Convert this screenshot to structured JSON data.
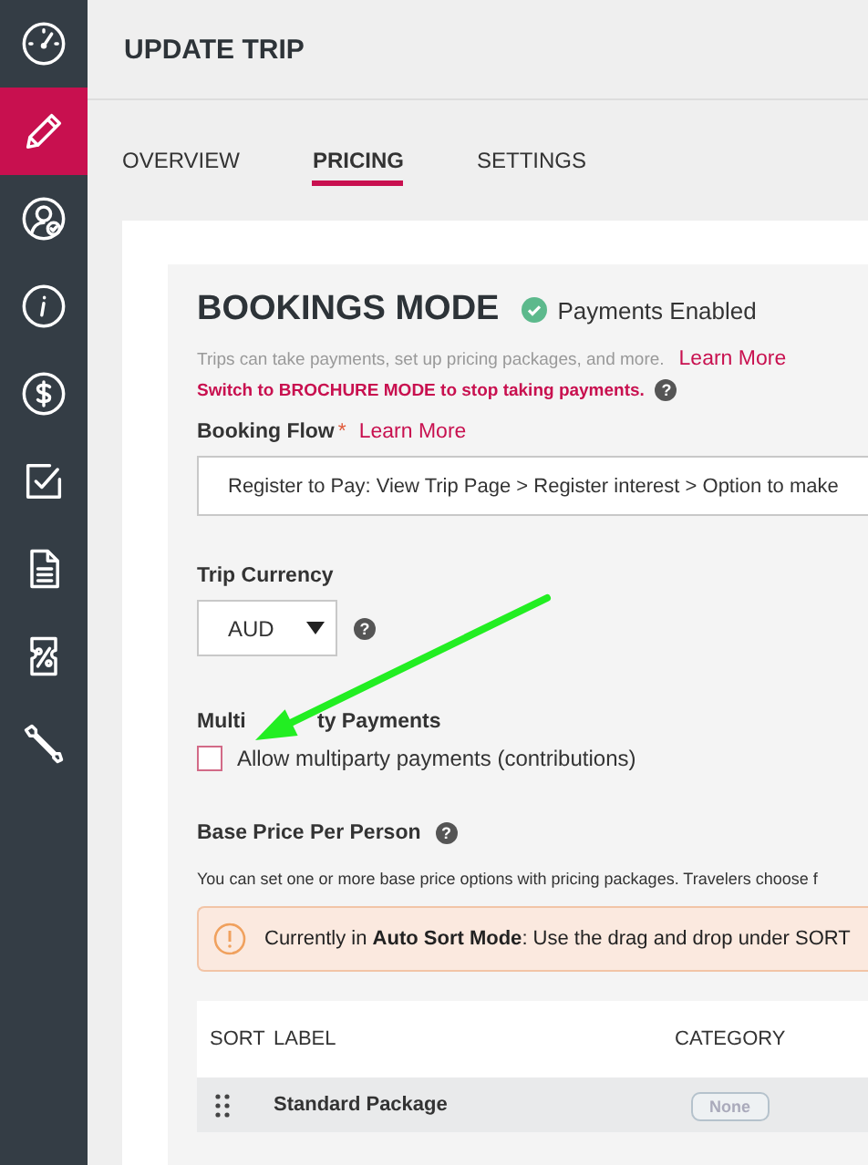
{
  "sidebar": {
    "items": [
      {
        "kind": "gauge",
        "selected": false
      },
      {
        "kind": "pencil",
        "selected": true
      },
      {
        "kind": "user",
        "selected": false
      },
      {
        "kind": "info",
        "selected": false
      },
      {
        "kind": "dollar",
        "selected": false
      },
      {
        "kind": "check",
        "selected": false
      },
      {
        "kind": "document",
        "selected": false
      },
      {
        "kind": "ticket",
        "selected": false
      },
      {
        "kind": "wrench",
        "selected": false
      }
    ]
  },
  "header": {
    "title": "UPDATE TRIP"
  },
  "tabs": [
    {
      "label": "OVERVIEW",
      "selected": false
    },
    {
      "label": "PRICING",
      "selected": true
    },
    {
      "label": "SETTINGS",
      "selected": false
    }
  ],
  "mode": {
    "title": "BOOKINGS MODE",
    "status": "Payments Enabled",
    "enabled": true,
    "description": "Trips can take payments, set up pricing packages, and more.",
    "learn_more": "Learn More",
    "switch_text": "Switch to BROCHURE MODE to stop taking payments.",
    "help": "?"
  },
  "booking_flow": {
    "label": "Booking Flow",
    "required_mark": "*",
    "learn_more": "Learn More",
    "value": "Register to Pay: View Trip Page > Register interest > Option to make"
  },
  "currency": {
    "label": "Trip Currency",
    "value": "AUD",
    "help": "?"
  },
  "multiparty": {
    "label_parts": [
      "Multi",
      "ty Payments"
    ],
    "option": "Allow multiparty payments (contributions)",
    "checked": false
  },
  "base_price": {
    "label": "Base Price Per Person",
    "help": "?",
    "description": "You can set one or more base price options with pricing packages. Travelers choose f",
    "alert": "Currently in **Auto Sort Mode**: Use the drag and drop under SORT"
  },
  "table": {
    "columns": [
      "SORT",
      "LABEL",
      "CATEGORY"
    ],
    "rows": [
      {
        "label": "Standard Package",
        "category": "None"
      }
    ]
  }
}
